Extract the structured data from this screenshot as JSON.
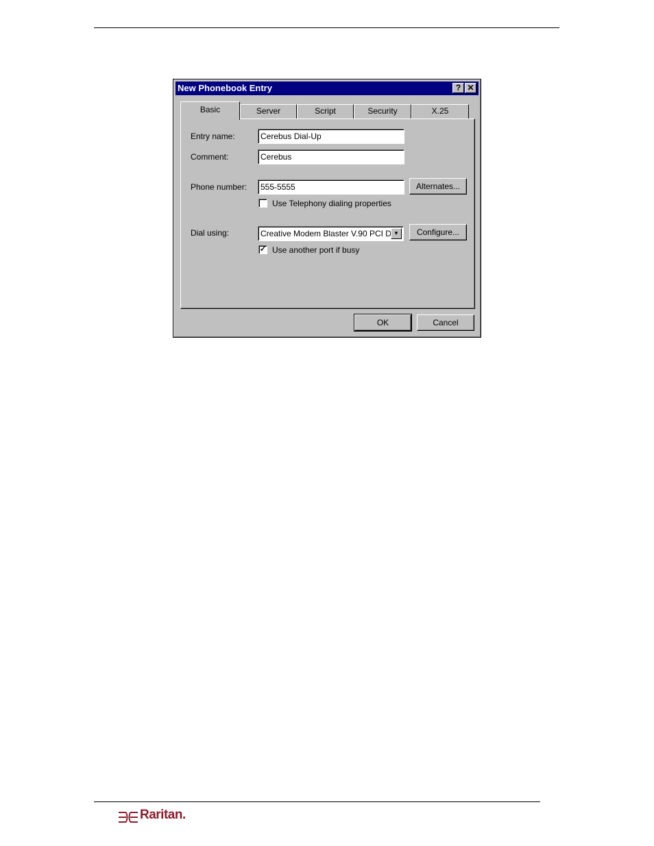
{
  "dialog": {
    "title": "New Phonebook Entry",
    "help_glyph": "?",
    "close_glyph": "✕",
    "tabs": [
      {
        "label": "Basic",
        "active": true
      },
      {
        "label": "Server",
        "active": false
      },
      {
        "label": "Script",
        "active": false
      },
      {
        "label": "Security",
        "active": false
      },
      {
        "label": "X.25",
        "active": false
      }
    ],
    "fields": {
      "entry_name_label": "Entry name:",
      "entry_name_value": "Cerebus Dial-Up",
      "comment_label": "Comment:",
      "comment_value": "Cerebus",
      "phone_label": "Phone number:",
      "phone_value": "555-5555",
      "alternates_label": "Alternates...",
      "telephony_label": "Use Telephony dialing properties",
      "telephony_checked": false,
      "dial_label": "Dial using:",
      "dial_value": "Creative Modem Blaster V.90 PCI D",
      "configure_label": "Configure...",
      "busy_label": "Use another port if busy",
      "busy_checked": true,
      "check_glyph": "✓",
      "arrow_glyph": "▼"
    },
    "ok_label": "OK",
    "cancel_label": "Cancel"
  },
  "footer": {
    "logo_text": "Raritan."
  },
  "colors": {
    "titlebar": "#000080",
    "face": "#c0c0c0",
    "logo": "#8c1d2c"
  }
}
